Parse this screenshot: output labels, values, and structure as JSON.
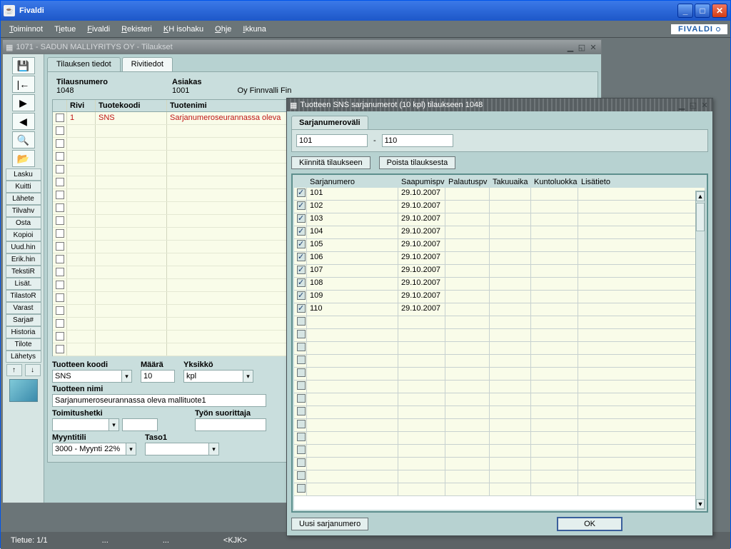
{
  "outer": {
    "title": "Fivaldi"
  },
  "menu": {
    "items": [
      "Toiminnot",
      "Tietue",
      "Fivaldi",
      "Rekisteri",
      "KH isohaku",
      "Ohje",
      "Ikkuna"
    ]
  },
  "brand": "FIVALDI",
  "mdi": {
    "title": "1071 - SADUN MALLIYRITYS OY - Tilaukset"
  },
  "toolbar": {
    "buttons": [
      "Lasku",
      "Kuitti",
      "Lähete",
      "Tilvahv",
      "Osta",
      "Kopioi",
      "Uud.hin",
      "Erik.hin",
      "TekstiR",
      "Lisät.",
      "TilastoR",
      "Varast",
      "Sarja#",
      "Historia",
      "Tilote",
      "Lähetys"
    ]
  },
  "tabs": {
    "t1": "Tilauksen tiedot",
    "t2": "Rivitiedot"
  },
  "header": {
    "tilausnumero_lbl": "Tilausnumero",
    "tilausnumero": "1048",
    "asiakas_lbl": "Asiakas",
    "asiakas": "1001",
    "asiakas_name": "Oy Finnvalli Fin"
  },
  "main_table": {
    "cols": {
      "rivi": "Rivi",
      "koodi": "Tuotekoodi",
      "nimi": "Tuotenimi"
    },
    "row": {
      "rivi": "1",
      "koodi": "SNS",
      "nimi": "Sarjanumeroseurannassa oleva"
    }
  },
  "form": {
    "tuotteen_koodi_lbl": "Tuotteen koodi",
    "tuotteen_koodi": "SNS",
    "maara_lbl": "Määrä",
    "maara": "10",
    "yksikko_lbl": "Yksikkö",
    "yksikko": "kpl",
    "tuotteen_nimi_lbl": "Tuotteen nimi",
    "tuotteen_nimi": "Sarjanumeroseurannassa oleva mallituote1",
    "toimitushetki_lbl": "Toimitushetki",
    "tyon_suorittaja_lbl": "Työn suorittaja",
    "myyntitili_lbl": "Myyntitili",
    "myyntitili": "3000 - Myynti 22%",
    "taso1_lbl": "Taso1"
  },
  "dialog": {
    "title": "Tuotteen SNS sarjanumerot (10 kpl) tilaukseen 1048",
    "tab": "Sarjanumeroväli",
    "range_from": "101",
    "range_to": "110",
    "dash": "-",
    "btn_kiinnita": "Kiinnitä tilaukseen",
    "btn_poista": "Poista tilauksesta",
    "cols": {
      "sn": "Sarjanumero",
      "sp": "Saapumispv",
      "pp": "Palautuspv",
      "ta": "Takuuaika",
      "kl": "Kuntoluokka",
      "lt": "Lisätieto"
    },
    "btn_uusi": "Uusi sarjanumero",
    "btn_ok": "OK"
  },
  "chart_data": {
    "type": "table",
    "title": "Tuotteen SNS sarjanumerot (10 kpl) tilaukseen 1048",
    "columns": [
      "Sarjanumero",
      "Saapumispv",
      "Palautuspv",
      "Takuuaika",
      "Kuntoluokka",
      "Lisätieto"
    ],
    "rows": [
      {
        "checked": true,
        "Sarjanumero": "101",
        "Saapumispv": "29.10.2007",
        "Palautuspv": "",
        "Takuuaika": "",
        "Kuntoluokka": "",
        "Lisätieto": ""
      },
      {
        "checked": true,
        "Sarjanumero": "102",
        "Saapumispv": "29.10.2007",
        "Palautuspv": "",
        "Takuuaika": "",
        "Kuntoluokka": "",
        "Lisätieto": ""
      },
      {
        "checked": true,
        "Sarjanumero": "103",
        "Saapumispv": "29.10.2007",
        "Palautuspv": "",
        "Takuuaika": "",
        "Kuntoluokka": "",
        "Lisätieto": ""
      },
      {
        "checked": true,
        "Sarjanumero": "104",
        "Saapumispv": "29.10.2007",
        "Palautuspv": "",
        "Takuuaika": "",
        "Kuntoluokka": "",
        "Lisätieto": ""
      },
      {
        "checked": true,
        "Sarjanumero": "105",
        "Saapumispv": "29.10.2007",
        "Palautuspv": "",
        "Takuuaika": "",
        "Kuntoluokka": "",
        "Lisätieto": ""
      },
      {
        "checked": true,
        "Sarjanumero": "106",
        "Saapumispv": "29.10.2007",
        "Palautuspv": "",
        "Takuuaika": "",
        "Kuntoluokka": "",
        "Lisätieto": ""
      },
      {
        "checked": true,
        "Sarjanumero": "107",
        "Saapumispv": "29.10.2007",
        "Palautuspv": "",
        "Takuuaika": "",
        "Kuntoluokka": "",
        "Lisätieto": ""
      },
      {
        "checked": true,
        "Sarjanumero": "108",
        "Saapumispv": "29.10.2007",
        "Palautuspv": "",
        "Takuuaika": "",
        "Kuntoluokka": "",
        "Lisätieto": ""
      },
      {
        "checked": true,
        "Sarjanumero": "109",
        "Saapumispv": "29.10.2007",
        "Palautuspv": "",
        "Takuuaika": "",
        "Kuntoluokka": "",
        "Lisätieto": ""
      },
      {
        "checked": true,
        "Sarjanumero": "110",
        "Saapumispv": "29.10.2007",
        "Palautuspv": "",
        "Takuuaika": "",
        "Kuntoluokka": "",
        "Lisätieto": ""
      }
    ]
  },
  "status": {
    "tietue": "Tietue: 1/1",
    "dots1": "...",
    "dots2": "...",
    "kjk": "<KJK>"
  }
}
